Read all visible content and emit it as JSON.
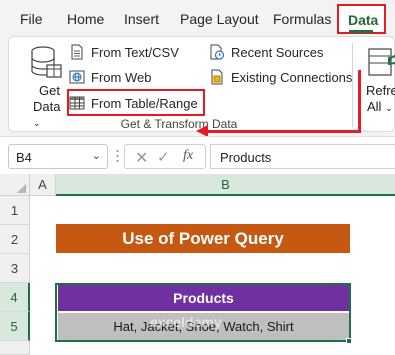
{
  "menu": {
    "tabs": [
      "File",
      "Home",
      "Insert",
      "Page Layout",
      "Formulas",
      "Data"
    ],
    "active_tab": "Data"
  },
  "ribbon": {
    "get_data": {
      "line1": "Get",
      "line2": "Data",
      "icon": "database-icon"
    },
    "from_text_csv": "From Text/CSV",
    "from_web": "From Web",
    "from_table_range": "From Table/Range",
    "recent_sources": "Recent Sources",
    "existing_connections": "Existing Connections",
    "group_label": "Get & Transform Data",
    "refresh_all": {
      "line1": "Refresh",
      "line2": "All"
    }
  },
  "formula_bar": {
    "name_box": "B4",
    "formula": "Products",
    "fx_label": "fx"
  },
  "grid": {
    "columns": [
      "A",
      "B"
    ],
    "rows": [
      "1",
      "2",
      "3",
      "4",
      "5"
    ],
    "title": "Use of Power Query",
    "header": "Products",
    "value": "Hat, Jacket, Shoe, Watch, Shirt",
    "watermark": "exceldemy"
  },
  "colors": {
    "title_bg": "#c65911",
    "header_bg": "#7030a0",
    "value_bg": "#bfbfbf",
    "highlight": "#e31b23",
    "excel_green": "#1e7145"
  }
}
